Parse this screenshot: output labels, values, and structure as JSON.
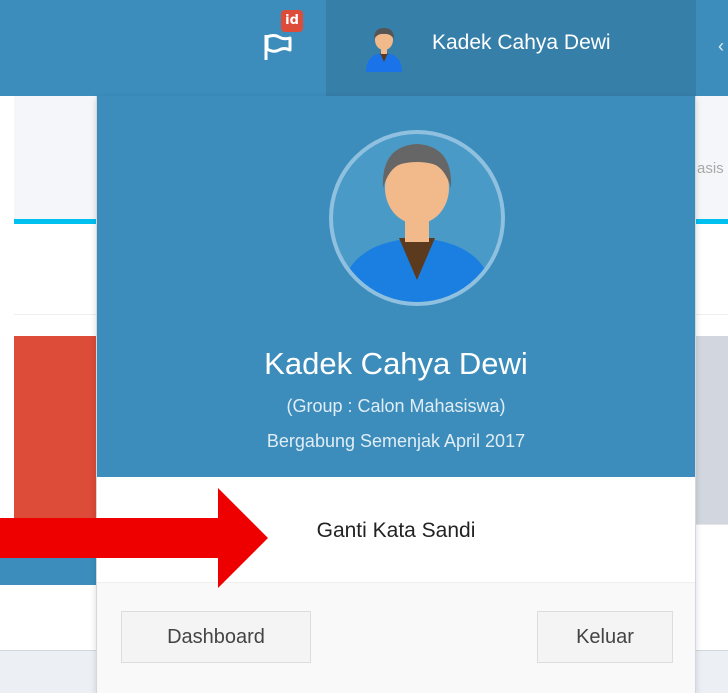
{
  "navbar": {
    "flag_icon": "flag-icon",
    "flag_badge": "id",
    "user_name": "Kadek Cahya Dewi",
    "edge_glyph": "‹"
  },
  "background": {
    "right_tab_text": "asis"
  },
  "dropdown": {
    "user": {
      "name": "Kadek Cahya Dewi",
      "group": "(Group : Calon Mahasiswa)",
      "member_since": "Bergabung Semenjak April 2017"
    },
    "body_link": "Ganti Kata Sandi",
    "footer": {
      "dashboard_label": "Dashboard",
      "logout_label": "Keluar"
    }
  },
  "annotation": {
    "icon": "red-arrow-icon",
    "color": "#ee0000"
  },
  "colors": {
    "primary": "#3c8dbc",
    "primary_dark": "#367fa9",
    "danger": "#dd4b39",
    "info": "#00c0ef"
  }
}
